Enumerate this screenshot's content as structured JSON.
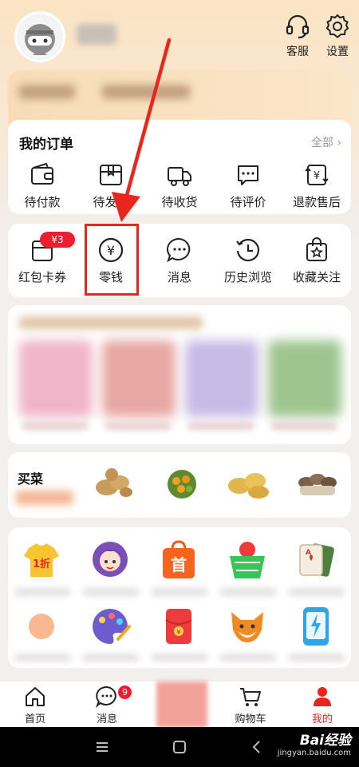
{
  "header": {
    "service_label": "客服",
    "settings_label": "设置"
  },
  "orders": {
    "title": "我的订单",
    "all_label": "全部 ›",
    "items": [
      {
        "label": "待付款",
        "icon": "wallet-icon"
      },
      {
        "label": "待发货",
        "icon": "package-icon"
      },
      {
        "label": "待收货",
        "icon": "truck-icon"
      },
      {
        "label": "待评价",
        "icon": "comment-icon"
      },
      {
        "label": "退款售后",
        "icon": "refund-icon"
      }
    ]
  },
  "tools": {
    "coupon_badge": "¥3",
    "items": [
      {
        "label": "红包卡券",
        "icon": "coupon-icon"
      },
      {
        "label": "零钱",
        "icon": "yuan-coin-icon"
      },
      {
        "label": "消息",
        "icon": "message-icon"
      },
      {
        "label": "历史浏览",
        "icon": "history-icon"
      },
      {
        "label": "收藏关注",
        "icon": "favorite-bag-icon"
      }
    ]
  },
  "grocery": {
    "title": "买菜"
  },
  "grid_icons": [
    "discount-tshirt-icon",
    "girl-avatar-icon",
    "shop-bag-icon",
    "fruit-basket-icon",
    "playing-cards-icon",
    "orange-fruit-icon",
    "palette-icon",
    "red-envelope-icon",
    "fox-mascot-icon",
    "phone-charge-icon"
  ],
  "grid_badge": "1折",
  "grid_shop_char": "首",
  "tabbar": {
    "items": [
      {
        "label": "首页",
        "icon": "home-icon"
      },
      {
        "label": "消息",
        "icon": "chat-icon"
      },
      {
        "label": "购物车",
        "icon": "cart-icon"
      },
      {
        "label": "我的",
        "icon": "person-icon"
      }
    ],
    "message_badge": "9"
  },
  "watermark": {
    "brand": "Bai经验",
    "url": "jingyan.baidu.com"
  },
  "colors": {
    "accent": "#e8261c",
    "badge": "#ee1d2f",
    "header_bg": "#fbe4c4",
    "page_bg": "#f2efed"
  }
}
